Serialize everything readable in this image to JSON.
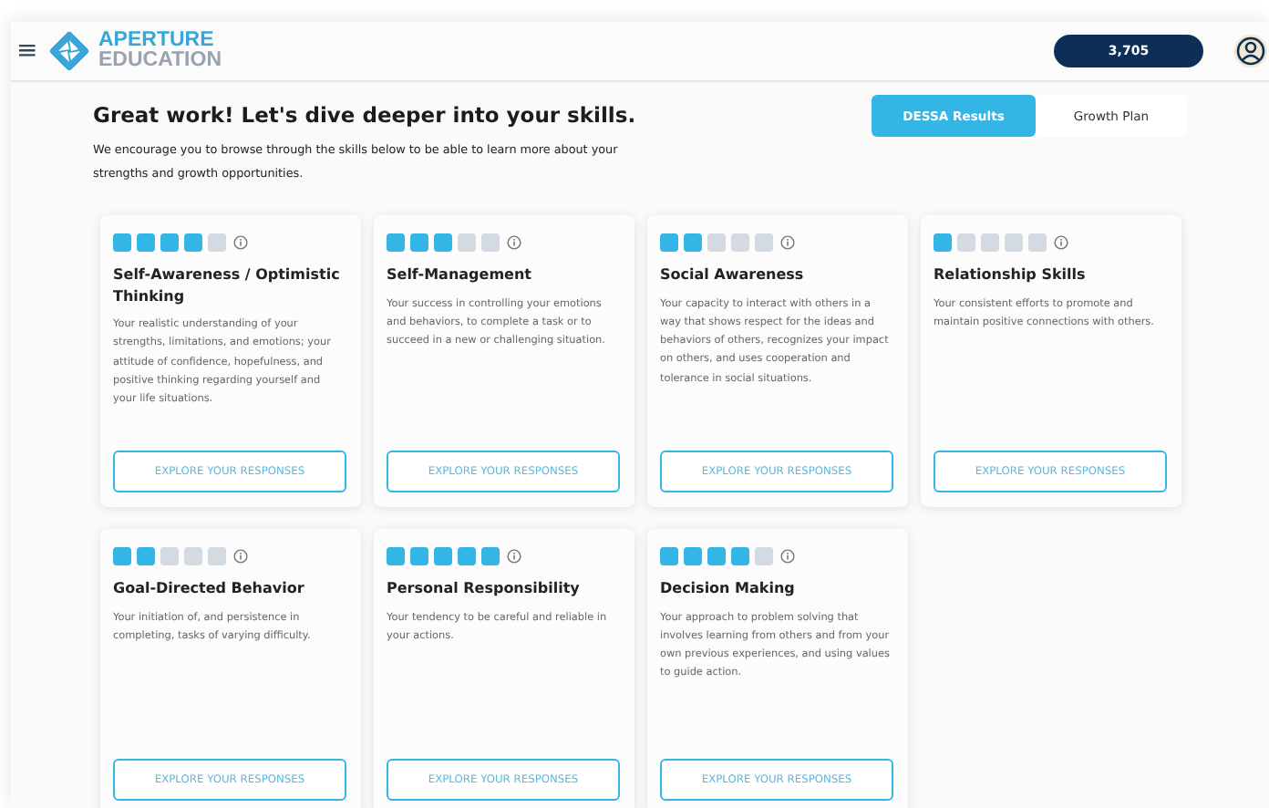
{
  "header": {
    "menu_icon": "≡",
    "brand": {
      "line1": "APERTURE",
      "line2": "EDUCATION"
    },
    "points": "3,705"
  },
  "intro": {
    "title": "Great work! Let's dive deeper into your skills.",
    "text": "We encourage you to browse through the skills below to be able to learn more about your strengths and growth opportunities."
  },
  "tabs": [
    {
      "label": "DESSA Results",
      "selected": true
    },
    {
      "label": "Growth Plan",
      "selected": false
    }
  ],
  "skills": [
    {
      "title": "Self-Awareness / Optimistic Thinking",
      "stars": 4,
      "description": "Your realistic understanding of your strengths, limitations, and emotions; your attitude of confidence, hopefulness, and positive thinking regarding yourself and your life situations.",
      "button": "EXPLORE YOUR RESPONSES"
    },
    {
      "title": "Self-Management",
      "stars": 3,
      "description": "Your success in controlling your emotions and behaviors, to complete a task or to succeed in a new or challenging situation.",
      "button": "EXPLORE YOUR RESPONSES"
    },
    {
      "title": "Social Awareness",
      "stars": 2,
      "description": "Your capacity to interact with others in a way that shows respect for the ideas and behaviors of others, recognizes your impact on others, and uses cooperation and tolerance in social situations.",
      "button": "EXPLORE YOUR RESPONSES"
    },
    {
      "title": "Relationship Skills",
      "stars": 1,
      "description": "Your consistent efforts to promote and maintain positive connections with others.",
      "button": "EXPLORE YOUR RESPONSES"
    },
    {
      "title": "Goal-Directed Behavior",
      "stars": 2,
      "description": "Your initiation of, and persistence in completing, tasks of varying difficulty.",
      "button": "EXPLORE YOUR RESPONSES"
    },
    {
      "title": "Personal Responsibility",
      "stars": 5,
      "description": "Your tendency to be careful and reliable in your actions.",
      "button": "EXPLORE YOUR RESPONSES"
    },
    {
      "title": "Decision Making",
      "stars": 4,
      "description": "Your approach to problem solving that involves learning from others and from your own previous experiences, and using values to guide action.",
      "button": "EXPLORE YOUR RESPONSES"
    }
  ]
}
